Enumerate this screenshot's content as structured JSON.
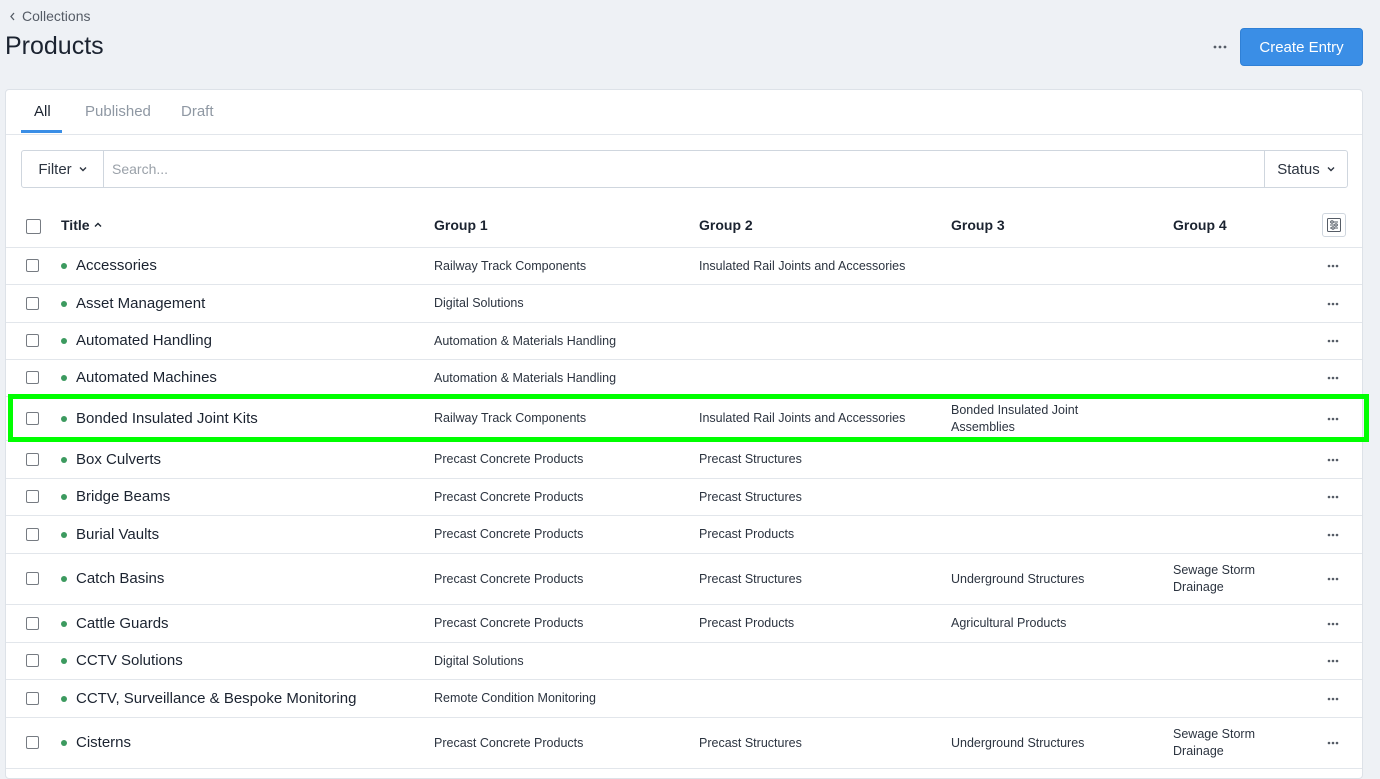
{
  "breadcrumb": {
    "label": "Collections"
  },
  "page": {
    "title": "Products",
    "create_label": "Create Entry"
  },
  "tabs": [
    {
      "label": "All",
      "active": true
    },
    {
      "label": "Published",
      "active": false
    },
    {
      "label": "Draft",
      "active": false
    }
  ],
  "toolbar": {
    "filter_label": "Filter",
    "search_placeholder": "Search...",
    "search_value": "",
    "status_label": "Status"
  },
  "columns": {
    "title": "Title",
    "group1": "Group 1",
    "group2": "Group 2",
    "group3": "Group 3",
    "group4": "Group 4"
  },
  "rows": [
    {
      "title": "Accessories",
      "group1": "Railway Track Components",
      "group2": "Insulated Rail Joints and Accessories",
      "group3": "",
      "group4": "",
      "status": "published"
    },
    {
      "title": "Asset Management",
      "group1": "Digital Solutions",
      "group2": "",
      "group3": "",
      "group4": "",
      "status": "published"
    },
    {
      "title": "Automated Handling",
      "group1": "Automation & Materials Handling",
      "group2": "",
      "group3": "",
      "group4": "",
      "status": "published"
    },
    {
      "title": "Automated Machines",
      "group1": "Automation & Materials Handling",
      "group2": "",
      "group3": "",
      "group4": "",
      "status": "published"
    },
    {
      "title": "Bonded Insulated Joint Kits",
      "group1": "Railway Track Components",
      "group2": "Insulated Rail Joints and Accessories",
      "group3": "Bonded Insulated Joint Assemblies",
      "group4": "",
      "status": "published",
      "highlighted": true
    },
    {
      "title": "Box Culverts",
      "group1": "Precast Concrete Products",
      "group2": "Precast Structures",
      "group3": "",
      "group4": "",
      "status": "published"
    },
    {
      "title": "Bridge Beams",
      "group1": "Precast Concrete Products",
      "group2": "Precast Structures",
      "group3": "",
      "group4": "",
      "status": "published"
    },
    {
      "title": "Burial Vaults",
      "group1": "Precast Concrete Products",
      "group2": "Precast Products",
      "group3": "",
      "group4": "",
      "status": "published"
    },
    {
      "title": "Catch Basins",
      "group1": "Precast Concrete Products",
      "group2": "Precast Structures",
      "group3": "Underground Structures",
      "group4": "Sewage Storm Drainage",
      "status": "published"
    },
    {
      "title": "Cattle Guards",
      "group1": "Precast Concrete Products",
      "group2": "Precast Products",
      "group3": "Agricultural Products",
      "group4": "",
      "status": "published"
    },
    {
      "title": "CCTV Solutions",
      "group1": "Digital Solutions",
      "group2": "",
      "group3": "",
      "group4": "",
      "status": "published"
    },
    {
      "title": "CCTV, Surveillance & Bespoke Monitoring",
      "group1": "Remote Condition Monitoring",
      "group2": "",
      "group3": "",
      "group4": "",
      "status": "published"
    },
    {
      "title": "Cisterns",
      "group1": "Precast Concrete Products",
      "group2": "Precast Structures",
      "group3": "Underground Structures",
      "group4": "Sewage Storm Drainage",
      "status": "published"
    }
  ],
  "colors": {
    "accent": "#3a8ee6",
    "published_dot": "#3c9a5f",
    "highlight": "#00ff00"
  }
}
